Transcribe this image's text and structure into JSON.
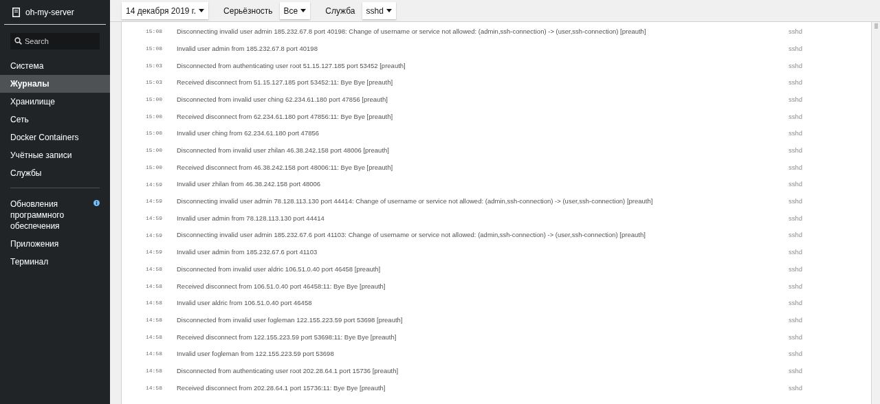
{
  "sidebar": {
    "host": "oh-my-server",
    "search": {
      "placeholder": "Search"
    },
    "groups": [
      [
        {
          "label": "Система",
          "selected": false,
          "notice": false
        },
        {
          "label": "Журналы",
          "selected": true,
          "notice": false
        },
        {
          "label": "Хранилище",
          "selected": false,
          "notice": false
        },
        {
          "label": "Сеть",
          "selected": false,
          "notice": false
        },
        {
          "label": "Docker Containers",
          "selected": false,
          "notice": false
        },
        {
          "label": "Учётные записи",
          "selected": false,
          "notice": false
        },
        {
          "label": "Службы",
          "selected": false,
          "notice": false
        }
      ],
      [
        {
          "label": "Обновления программного обеспечения",
          "selected": false,
          "notice": true
        },
        {
          "label": "Приложения",
          "selected": false,
          "notice": false
        },
        {
          "label": "Терминал",
          "selected": false,
          "notice": false
        }
      ]
    ]
  },
  "filters": {
    "date": "14 декабря 2019 г.",
    "severity_label": "Серьёзность",
    "severity": "Все",
    "service_label": "Служба",
    "service": "sshd"
  },
  "log": [
    {
      "time": "15:08",
      "message": "Disconnecting invalid user admin 185.232.67.8 port 40198: Change of username or service not allowed: (admin,ssh-connection) -> (user,ssh-connection) [preauth]",
      "service": "sshd"
    },
    {
      "time": "15:08",
      "message": "Invalid user admin from 185.232.67.8 port 40198",
      "service": "sshd"
    },
    {
      "time": "15:03",
      "message": "Disconnected from authenticating user root 51.15.127.185 port 53452 [preauth]",
      "service": "sshd"
    },
    {
      "time": "15:03",
      "message": "Received disconnect from 51.15.127.185 port 53452:11: Bye Bye [preauth]",
      "service": "sshd"
    },
    {
      "time": "15:00",
      "message": "Disconnected from invalid user ching 62.234.61.180 port 47856 [preauth]",
      "service": "sshd"
    },
    {
      "time": "15:00",
      "message": "Received disconnect from 62.234.61.180 port 47856:11: Bye Bye [preauth]",
      "service": "sshd"
    },
    {
      "time": "15:00",
      "message": "Invalid user ching from 62.234.61.180 port 47856",
      "service": "sshd"
    },
    {
      "time": "15:00",
      "message": "Disconnected from invalid user zhilan 46.38.242.158 port 48006 [preauth]",
      "service": "sshd"
    },
    {
      "time": "15:00",
      "message": "Received disconnect from 46.38.242.158 port 48006:11: Bye Bye [preauth]",
      "service": "sshd"
    },
    {
      "time": "14:59",
      "message": "Invalid user zhilan from 46.38.242.158 port 48006",
      "service": "sshd"
    },
    {
      "time": "14:59",
      "message": "Disconnecting invalid user admin 78.128.113.130 port 44414: Change of username or service not allowed: (admin,ssh-connection) -> (user,ssh-connection) [preauth]",
      "service": "sshd"
    },
    {
      "time": "14:59",
      "message": "Invalid user admin from 78.128.113.130 port 44414",
      "service": "sshd"
    },
    {
      "time": "14:59",
      "message": "Disconnecting invalid user admin 185.232.67.6 port 41103: Change of username or service not allowed: (admin,ssh-connection) -> (user,ssh-connection) [preauth]",
      "service": "sshd"
    },
    {
      "time": "14:59",
      "message": "Invalid user admin from 185.232.67.6 port 41103",
      "service": "sshd"
    },
    {
      "time": "14:58",
      "message": "Disconnected from invalid user aldric 106.51.0.40 port 46458 [preauth]",
      "service": "sshd"
    },
    {
      "time": "14:58",
      "message": "Received disconnect from 106.51.0.40 port 46458:11: Bye Bye [preauth]",
      "service": "sshd"
    },
    {
      "time": "14:58",
      "message": "Invalid user aldric from 106.51.0.40 port 46458",
      "service": "sshd"
    },
    {
      "time": "14:58",
      "message": "Disconnected from invalid user fogleman 122.155.223.59 port 53698 [preauth]",
      "service": "sshd"
    },
    {
      "time": "14:58",
      "message": "Received disconnect from 122.155.223.59 port 53698:11: Bye Bye [preauth]",
      "service": "sshd"
    },
    {
      "time": "14:58",
      "message": "Invalid user fogleman from 122.155.223.59 port 53698",
      "service": "sshd"
    },
    {
      "time": "14:58",
      "message": "Disconnected from authenticating user root 202.28.64.1 port 15736 [preauth]",
      "service": "sshd"
    },
    {
      "time": "14:58",
      "message": "Received disconnect from 202.28.64.1 port 15736:11: Bye Bye [preauth]",
      "service": "sshd"
    }
  ]
}
